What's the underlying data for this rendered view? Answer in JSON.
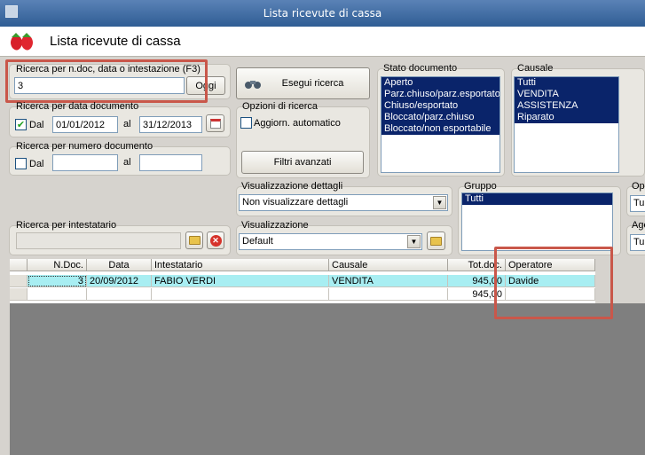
{
  "window": {
    "title": "Lista ricevute di cassa"
  },
  "header": {
    "title": "Lista ricevute di cassa",
    "icon": "strawberry-icon"
  },
  "search": {
    "label": "Ricerca per n.doc, data o intestazione (F3)",
    "value": "3",
    "today_button": "Oggi",
    "execute_button": "Esegui ricerca"
  },
  "date_search": {
    "label": "Ricerca per data documento",
    "checked": true,
    "from_label": "Dal",
    "from": "01/01/2012",
    "to_label": "al",
    "to": "31/12/2013"
  },
  "number_search": {
    "label": "Ricerca per numero documento",
    "from_label": "Dal",
    "to_label": "al",
    "from": "",
    "to": ""
  },
  "options": {
    "label": "Opzioni di ricerca",
    "auto_update": "Aggiorn. automatico",
    "advanced_filters": "Filtri avanzati"
  },
  "stato": {
    "label": "Stato documento",
    "items": [
      "Aperto",
      "Parz.chiuso/parz.esportato",
      "Chiuso/esportato",
      "Bloccato/parz.chiuso",
      "Bloccato/non esportabile"
    ]
  },
  "causale": {
    "label": "Causale",
    "items": [
      "Tutti",
      "VENDITA",
      "ASSISTENZA",
      "Riparato"
    ]
  },
  "details": {
    "label": "Visualizzazione dettagli",
    "value": "Non visualizzare dettagli"
  },
  "gruppo": {
    "label": "Gruppo",
    "items": [
      "Tutti"
    ]
  },
  "operatore_filter": {
    "label": "Ope",
    "value": "Tu"
  },
  "agente_filter": {
    "label": "Age",
    "value": "Tu"
  },
  "intestatario": {
    "label": "Ricerca per intestatario",
    "value": ""
  },
  "visualizzazione": {
    "label": "Visualizzazione",
    "value": "Default"
  },
  "table": {
    "headers": [
      "N.Doc.",
      "Data",
      "Intestatario",
      "Causale",
      "Tot.doc.",
      "Operatore"
    ],
    "rows": [
      {
        "ndoc": "3",
        "data": "20/09/2012",
        "intestatario": "FABIO VERDI",
        "causale": "VENDITA",
        "tot": "945,00",
        "operatore": "Davide"
      }
    ],
    "total": "945,00"
  }
}
